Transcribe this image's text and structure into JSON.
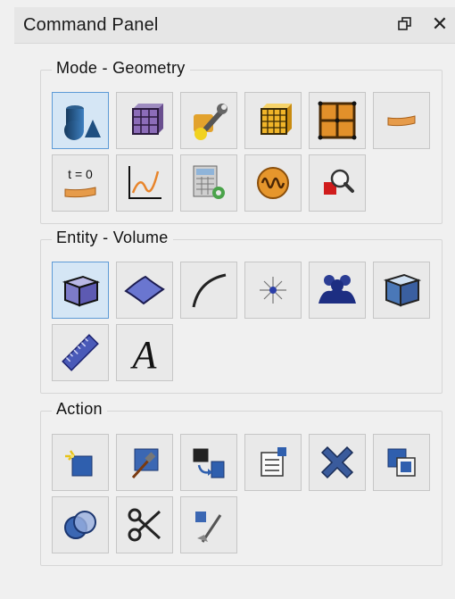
{
  "panel": {
    "title": "Command Panel",
    "restore_icon": "restore-window-icon",
    "close_glyph": "✕"
  },
  "groups": [
    {
      "label": "Mode - Geometry",
      "tools": [
        {
          "name": "geometry-mode",
          "icon": "geometry-shapes-icon",
          "active": true
        },
        {
          "name": "mesh-mode",
          "icon": "mesh-cube-icon",
          "active": false
        },
        {
          "name": "properties-mode",
          "icon": "wrench-material-icon",
          "active": false
        },
        {
          "name": "hex-mesh-mode",
          "icon": "orange-mesh-cube-icon",
          "active": false
        },
        {
          "name": "grid-mode",
          "icon": "grid-icon",
          "active": false
        },
        {
          "name": "boundary-conditions-mode",
          "icon": "beam-icon",
          "active": false
        },
        {
          "name": "initial-conditions-mode",
          "icon": "time-zero-icon",
          "label": "t = 0",
          "active": false
        },
        {
          "name": "analysis-plot-mode",
          "icon": "plot-curve-icon",
          "active": false
        },
        {
          "name": "analysis-setup-mode",
          "icon": "calculator-gear-icon",
          "active": false
        },
        {
          "name": "signal-mode",
          "icon": "wave-icon",
          "active": false
        },
        {
          "name": "inspect-mode",
          "icon": "magnifier-icon",
          "active": false
        }
      ]
    },
    {
      "label": "Entity - Volume",
      "tools": [
        {
          "name": "volume-entity",
          "icon": "volume-cube-icon",
          "active": true
        },
        {
          "name": "surface-entity",
          "icon": "surface-icon",
          "active": false
        },
        {
          "name": "curve-entity",
          "icon": "curve-icon",
          "active": false
        },
        {
          "name": "vertex-entity",
          "icon": "vertex-icon",
          "active": false
        },
        {
          "name": "group-entity",
          "icon": "group-people-icon",
          "active": false
        },
        {
          "name": "body-entity",
          "icon": "body-cube-icon",
          "active": false
        },
        {
          "name": "measure-entity",
          "icon": "ruler-icon",
          "active": false
        },
        {
          "name": "label-entity",
          "icon": "text-label-icon",
          "label": "A",
          "active": false
        }
      ]
    },
    {
      "label": "Action",
      "tools": [
        {
          "name": "create-action",
          "icon": "create-sparkle-icon",
          "active": false
        },
        {
          "name": "modify-action",
          "icon": "modify-hammer-icon",
          "active": false
        },
        {
          "name": "transform-action",
          "icon": "transform-icon",
          "active": false
        },
        {
          "name": "properties-action",
          "icon": "properties-list-icon",
          "active": false
        },
        {
          "name": "delete-action",
          "icon": "delete-x-icon",
          "active": false
        },
        {
          "name": "copy-action",
          "icon": "copy-squares-icon",
          "active": false
        },
        {
          "name": "boolean-action",
          "icon": "boolean-rings-icon",
          "active": false
        },
        {
          "name": "cut-action",
          "icon": "scissors-icon",
          "active": false
        },
        {
          "name": "cleanup-action",
          "icon": "broom-cube-icon",
          "active": false
        }
      ]
    }
  ]
}
